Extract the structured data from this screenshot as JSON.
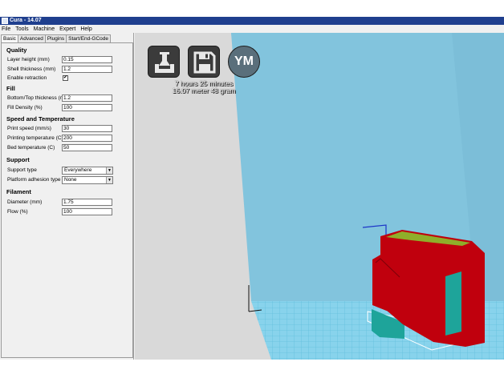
{
  "window": {
    "title": "Cura - 14.07"
  },
  "menu": [
    "File",
    "Tools",
    "Machine",
    "Expert",
    "Help"
  ],
  "tabs": [
    "Basic",
    "Advanced",
    "Plugins",
    "Start/End-GCode"
  ],
  "quality": {
    "title": "Quality",
    "layer_height_label": "Layer height (mm)",
    "layer_height": "0.15",
    "shell_thickness_label": "Shell thickness (mm)",
    "shell_thickness": "1.2",
    "enable_retraction_label": "Enable retraction",
    "enable_retraction": "✔"
  },
  "fill": {
    "title": "Fill",
    "bottom_top_label": "Bottom/Top thickness (mm)",
    "bottom_top": "1.2",
    "density_label": "Fill Density (%)",
    "density": "100"
  },
  "speed": {
    "title": "Speed and Temperature",
    "print_speed_label": "Print speed (mm/s)",
    "print_speed": "30",
    "print_temp_label": "Printing temperature (C)",
    "print_temp": "200",
    "bed_temp_label": "Bed temperature (C)",
    "bed_temp": "50"
  },
  "support": {
    "title": "Support",
    "type_label": "Support type",
    "type": "Everywhere",
    "adhesion_label": "Platform adhesion type",
    "adhesion": "None"
  },
  "filament": {
    "title": "Filament",
    "diameter_label": "Diameter (mm)",
    "diameter": "1.75",
    "flow_label": "Flow (%)",
    "flow": "100"
  },
  "toolbar": {
    "ym_label": "YM"
  },
  "print_info": {
    "time": "7 hours 25 minutes",
    "material": "16.07 meter 48 gram"
  },
  "colors": {
    "title_bar": "#1f3f8e",
    "viewport_back": "#82c4dd",
    "viewport_wall": "#d9d9d9",
    "grid": "#7fd6ee",
    "model_red": "#c0000d",
    "model_teal": "#1ea49a",
    "model_top": "#8fae2a"
  }
}
